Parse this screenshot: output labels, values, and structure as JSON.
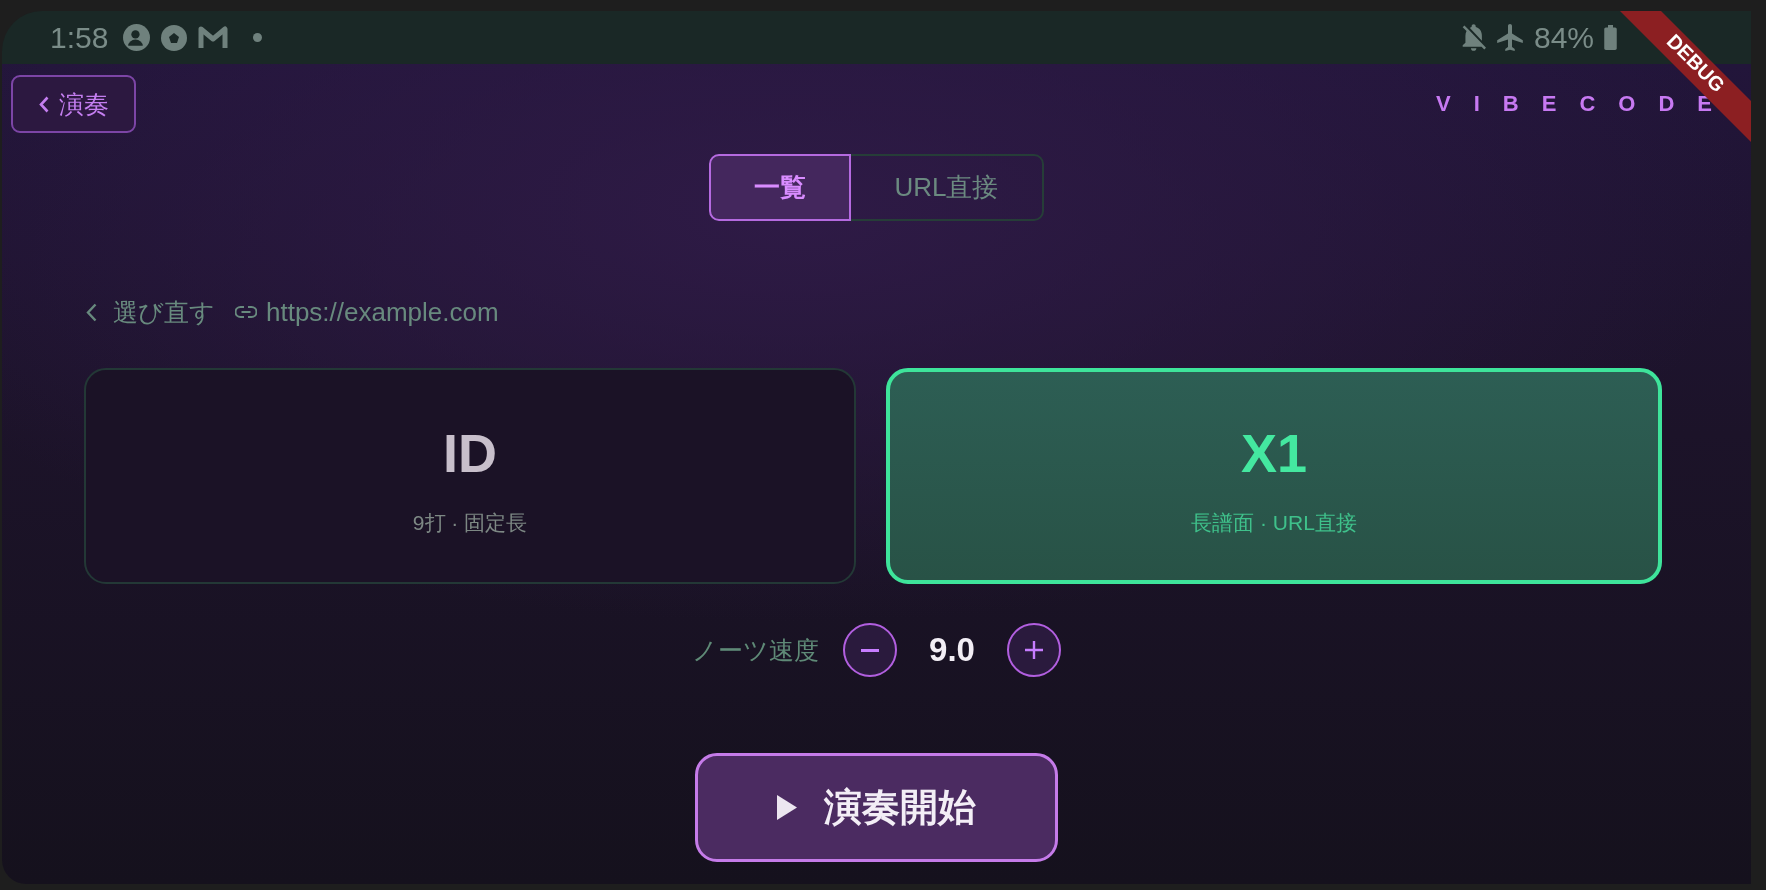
{
  "status_bar": {
    "time": "1:58",
    "battery": "84%"
  },
  "debug_banner": {
    "label": "DEBUG"
  },
  "header": {
    "back_button": {
      "label": "演奏"
    },
    "brand": "VIBECODE"
  },
  "tabs": [
    {
      "label": "一覧",
      "selected": true
    },
    {
      "label": "URL直接",
      "selected": false
    }
  ],
  "source": {
    "reselect": "選び直す",
    "url": "https://example.com"
  },
  "modes": [
    {
      "title": "ID",
      "subtitle": "9打 · 固定長",
      "selected": false
    },
    {
      "title": "X1",
      "subtitle": "長譜面 · URL直接",
      "selected": true
    }
  ],
  "speed": {
    "label": "ノーツ速度",
    "value": "9.0"
  },
  "start_button": {
    "label": "演奏開始"
  }
}
